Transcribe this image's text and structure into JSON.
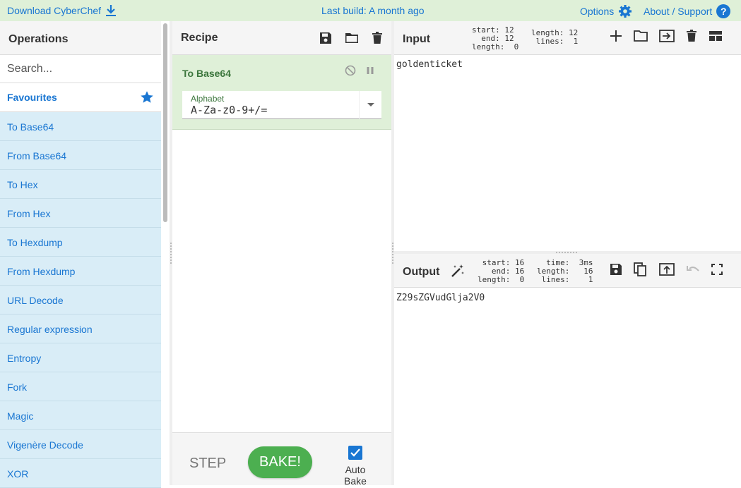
{
  "banner": {
    "download_label": "Download CyberChef",
    "build_label": "Last build: A month ago",
    "options_label": "Options",
    "about_label": "About / Support",
    "help_glyph": "?"
  },
  "operations": {
    "title": "Operations",
    "search_placeholder": "Search...",
    "favourites_label": "Favourites",
    "items": [
      {
        "label": "To Base64"
      },
      {
        "label": "From Base64"
      },
      {
        "label": "To Hex"
      },
      {
        "label": "From Hex"
      },
      {
        "label": "To Hexdump"
      },
      {
        "label": "From Hexdump"
      },
      {
        "label": "URL Decode"
      },
      {
        "label": "Regular expression"
      },
      {
        "label": "Entropy"
      },
      {
        "label": "Fork"
      },
      {
        "label": "Magic"
      },
      {
        "label": "Vigenère Decode"
      },
      {
        "label": "XOR"
      }
    ]
  },
  "recipe": {
    "title": "Recipe",
    "operation": {
      "name": "To Base64",
      "field_label": "Alphabet",
      "field_value": "A-Za-z0-9+/="
    },
    "step_label": "STEP",
    "bake_label": "BAKE!",
    "auto_bake_label": "Auto Bake",
    "auto_bake_checked": true
  },
  "input": {
    "title": "Input",
    "stats_left": "start: 12\n  end: 12\nlength:  0",
    "stats_right": "length: 12\n lines:  1",
    "text": "goldenticket"
  },
  "output": {
    "title": "Output",
    "stats_left": " start: 16\n   end: 16\nlength:  0",
    "stats_right": "  time:  3ms\nlength:   16\n lines:    1",
    "text": "Z29sZGVudGlja2V0"
  },
  "colors": {
    "accent": "#1976d2",
    "banner_bg": "#dff0d8",
    "op_bg": "#d9edf7",
    "recipe_op_bg": "#dff0d8",
    "bake": "#4caf50"
  }
}
